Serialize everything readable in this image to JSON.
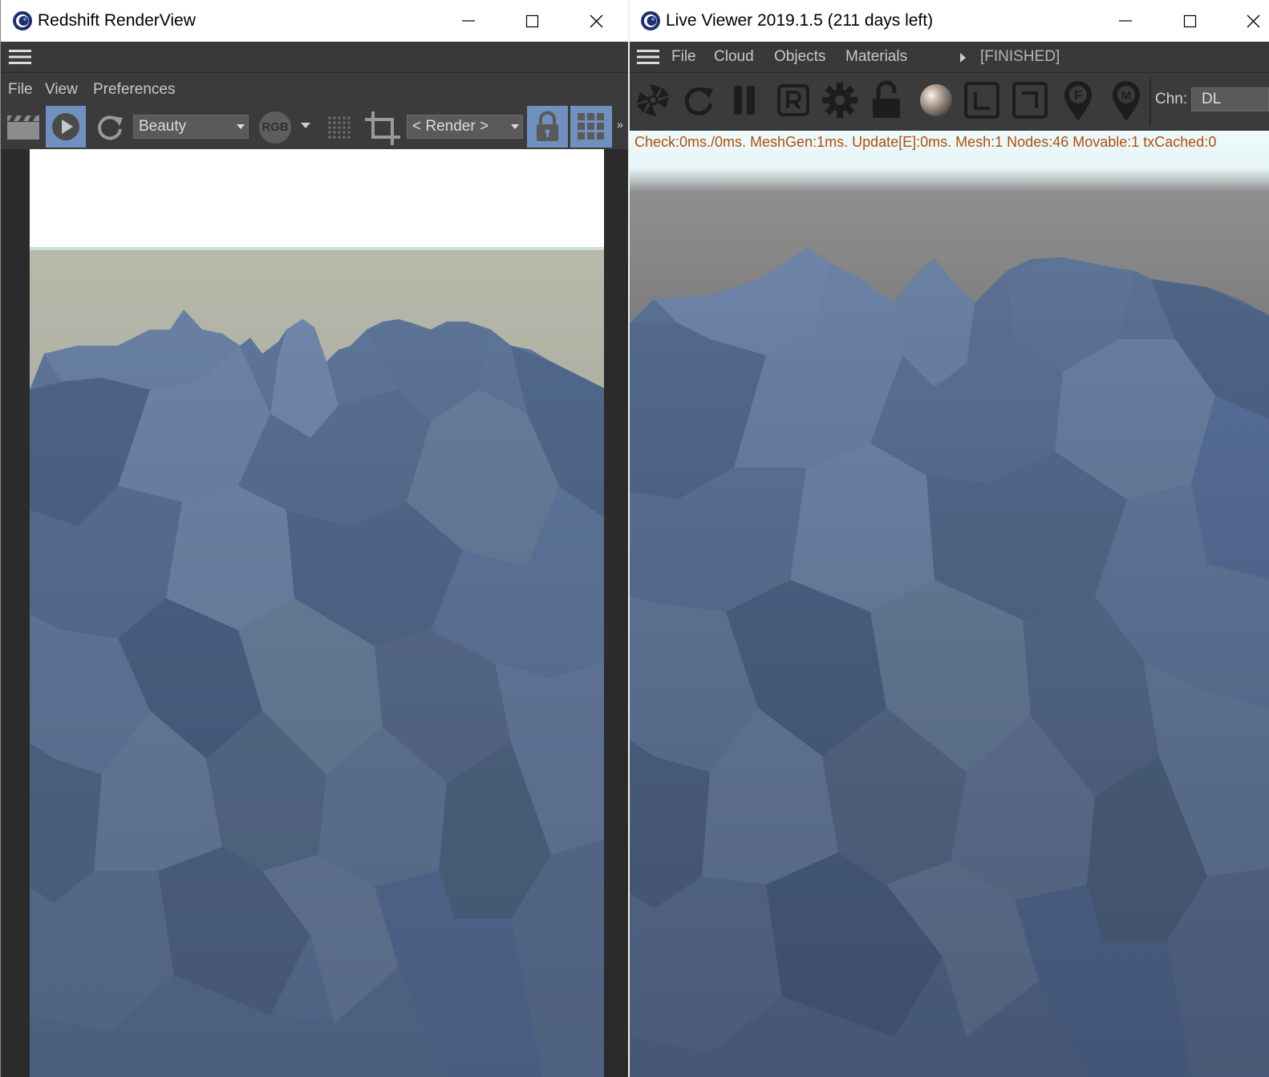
{
  "left_window": {
    "title": "Redshift RenderView",
    "menu": {
      "file": "File",
      "view": "View",
      "preferences": "Preferences"
    },
    "toolbar": {
      "aov_select": "Beauty",
      "rgb_label": "RGB",
      "camera_select": "< Render >",
      "overflow": "»"
    }
  },
  "right_window": {
    "title": "Live Viewer 2019.1.5 (211 days left)",
    "menu": {
      "file": "File",
      "cloud": "Cloud",
      "objects": "Objects",
      "materials": "Materials"
    },
    "status_badge": "[FINISHED]",
    "toolbar": {
      "region_f": "F",
      "region_m": "M",
      "channel_label": "Chn:",
      "channel_value": "DL"
    },
    "stats_text": "Check:0ms./0ms. MeshGen:1ms. Update[E]:0ms. Mesh:1 Nodes:46 Movable:1 txCached:0"
  },
  "icons": {
    "clapper": "clapper-icon",
    "play": "play-icon",
    "refresh": "refresh-icon",
    "dots_grid": "dots-grid-icon",
    "crop": "crop-icon",
    "lock": "lock-icon",
    "grid": "grid-icon",
    "aperture": "aperture-icon",
    "pause": "pause-icon",
    "settings": "gear-icon",
    "unlock": "unlock-icon",
    "material": "material-sphere-icon",
    "pin": "pin-icon"
  },
  "colors": {
    "titlebar_bg": "#ffffff",
    "panel_bg": "#3b3b3b",
    "active_button": "#7090c0",
    "status_text": "#b14d0e",
    "terrain_blue": "#5b7397"
  }
}
